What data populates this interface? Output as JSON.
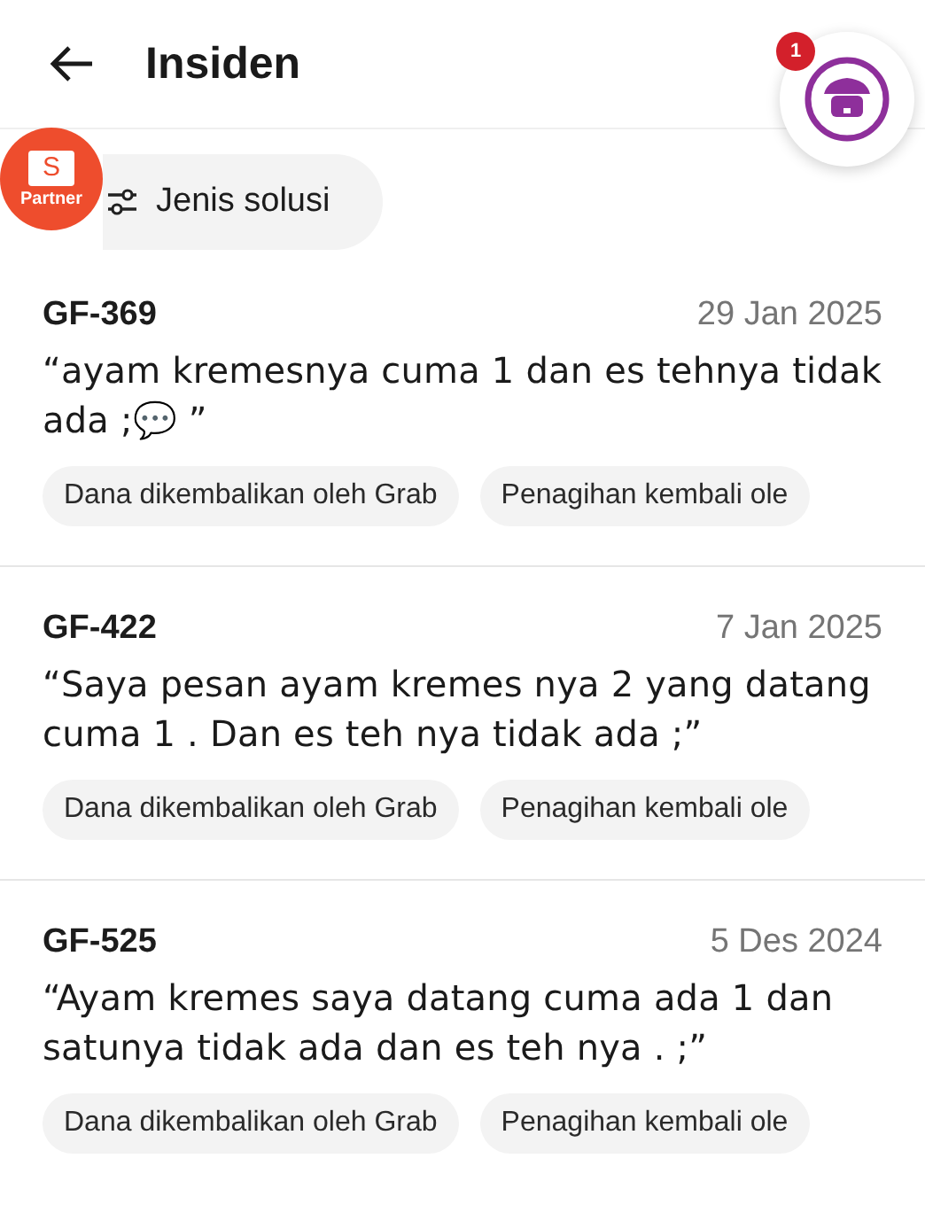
{
  "header": {
    "title": "Insiden",
    "store_badge": "1"
  },
  "partner_logo": {
    "letter": "S",
    "label": "Partner"
  },
  "filter": {
    "label": "Jenis solusi"
  },
  "incidents": [
    {
      "id": "GF-369",
      "date": "29 Jan 2025",
      "comment": "“ayam kremesnya cuma 1 dan es tehnya tidak ada ;💬 ”",
      "tags": [
        "Dana dikembalikan oleh Grab",
        "Penagihan kembali ole"
      ]
    },
    {
      "id": "GF-422",
      "date": "7 Jan 2025",
      "comment": "“Saya pesan ayam kremes nya 2 yang datang cuma 1 . Dan es teh nya tidak ada ;”",
      "tags": [
        "Dana dikembalikan oleh Grab",
        "Penagihan kembali ole"
      ]
    },
    {
      "id": "GF-525",
      "date": "5 Des 2024",
      "comment": "“Ayam kremes saya datang cuma ada 1 dan satunya tidak ada dan es teh nya . ;”",
      "tags": [
        "Dana dikembalikan oleh Grab",
        "Penagihan kembali ole"
      ]
    }
  ]
}
